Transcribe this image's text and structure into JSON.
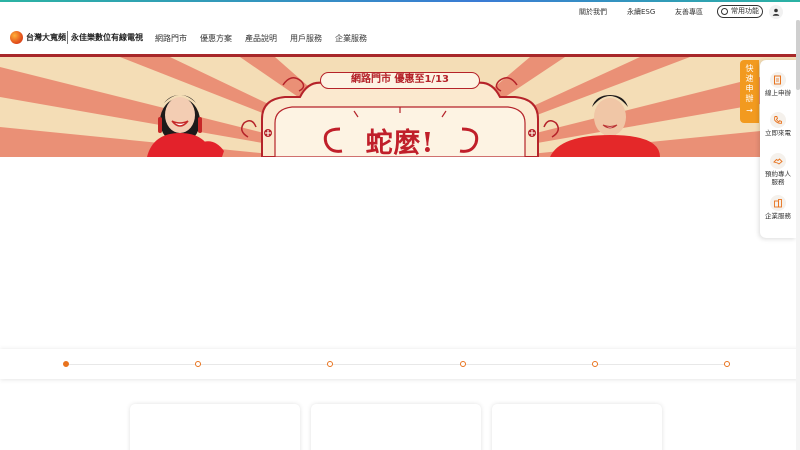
{
  "utility_bar": {
    "links": [
      "關於我們",
      "永續ESG",
      "友善專區"
    ],
    "quick_functions_label": "常用功能"
  },
  "brand": {
    "logo_text": "台灣大寬頻",
    "sub_brand": "永佳樂數位有線電視"
  },
  "nav": {
    "items": [
      "網路門市",
      "優惠方案",
      "產品說明",
      "用戶服務",
      "企業服務"
    ]
  },
  "hero": {
    "headline": "網路門市 優惠至1/13",
    "title": "蛇麼!"
  },
  "quick_apply": {
    "label": "快速申辦",
    "arrow": "→"
  },
  "side_panel": {
    "items": [
      {
        "label": "線上申辦",
        "icon": "form-icon"
      },
      {
        "label": "立即來電",
        "icon": "phone-icon"
      },
      {
        "label": "預約專人服務",
        "icon": "handshake-icon"
      },
      {
        "label": "企業服務",
        "icon": "building-icon"
      }
    ]
  },
  "carousel": {
    "slide_count": 6,
    "active_index": 0
  },
  "colors": {
    "accent_orange": "#e8731e",
    "brand_red": "#a8282a",
    "quick_apply_orange": "#f29a1f"
  }
}
